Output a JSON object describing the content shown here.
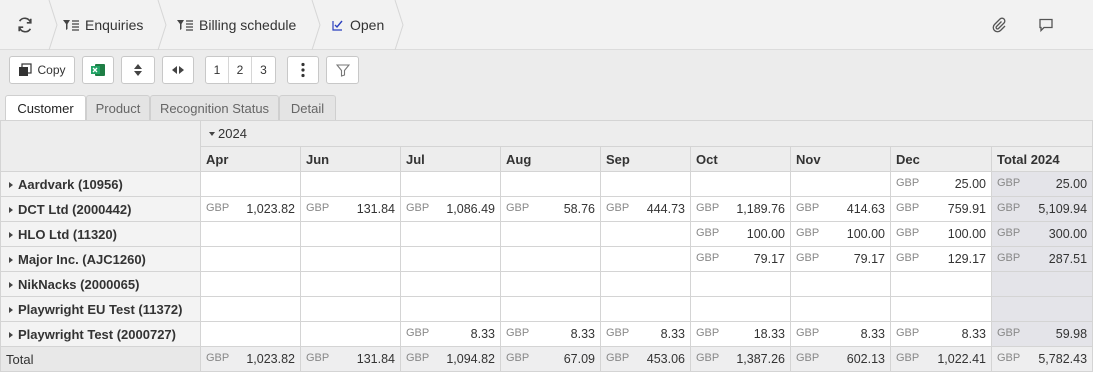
{
  "topbar": {
    "crumbs": [
      {
        "label": "Enquiries"
      },
      {
        "label": "Billing schedule"
      },
      {
        "label": "Open"
      }
    ]
  },
  "toolbar": {
    "copy_label": "Copy",
    "pages": [
      "1",
      "2",
      "3"
    ]
  },
  "tabs": [
    {
      "label": "Customer",
      "active": true
    },
    {
      "label": "Product"
    },
    {
      "label": "Recognition Status"
    },
    {
      "label": "Detail"
    }
  ],
  "grid": {
    "year_label": "2024",
    "columns": [
      "Apr",
      "Jun",
      "Jul",
      "Aug",
      "Sep",
      "Oct",
      "Nov",
      "Dec",
      "Total 2024"
    ],
    "currency": "GBP",
    "rows": [
      {
        "label": "Aardvark (10956)",
        "values": [
          "",
          "",
          "",
          "",
          "",
          "",
          "",
          "25.00",
          "25.00"
        ]
      },
      {
        "label": "DCT Ltd (2000442)",
        "values": [
          "1,023.82",
          "131.84",
          "1,086.49",
          "58.76",
          "444.73",
          "1,189.76",
          "414.63",
          "759.91",
          "5,109.94"
        ]
      },
      {
        "label": "HLO Ltd (11320)",
        "values": [
          "",
          "",
          "",
          "",
          "",
          "100.00",
          "100.00",
          "100.00",
          "300.00"
        ]
      },
      {
        "label": "Major Inc. (AJC1260)",
        "values": [
          "",
          "",
          "",
          "",
          "",
          "79.17",
          "79.17",
          "129.17",
          "287.51"
        ]
      },
      {
        "label": "NikNacks (2000065)",
        "values": [
          "",
          "",
          "",
          "",
          "",
          "",
          "",
          "",
          ""
        ]
      },
      {
        "label": "Playwright EU Test (11372)",
        "values": [
          "",
          "",
          "",
          "",
          "",
          "",
          "",
          "",
          ""
        ]
      },
      {
        "label": "Playwright Test (2000727)",
        "values": [
          "",
          "",
          "8.33",
          "8.33",
          "8.33",
          "18.33",
          "8.33",
          "8.33",
          "59.98"
        ]
      }
    ],
    "total": {
      "label": "Total",
      "values": [
        "1,023.82",
        "131.84",
        "1,094.82",
        "67.09",
        "453.06",
        "1,387.26",
        "602.13",
        "1,022.41",
        "5,782.43"
      ]
    }
  }
}
